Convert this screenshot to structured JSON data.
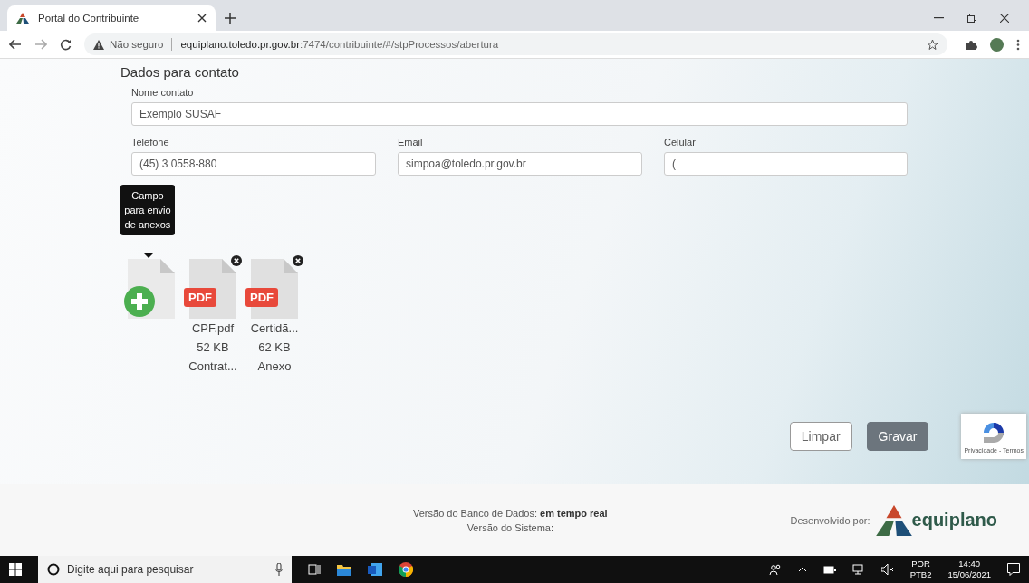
{
  "browser": {
    "tab_title": "Portal do Contribuinte",
    "security": "Não seguro",
    "url_host": "equiplano.toledo.pr.gov.br",
    "url_path": ":7474/contribuinte/#/stpProcessos/abertura"
  },
  "form": {
    "section_title": "Dados para contato",
    "fields": [
      {
        "label": "Nome contato",
        "value": "Exemplo SUSAF",
        "kind": "wide"
      },
      {
        "label": "Telefone",
        "value": "(45) 3 0558-880",
        "kind": "narrow"
      },
      {
        "label": "Email",
        "value": "simpoa@toledo.pr.gov.br",
        "kind": "narrow"
      },
      {
        "label": "Celular",
        "value": "(",
        "kind": "narrow"
      }
    ],
    "tooltip": "Campo para envio de anexos",
    "attachments": [
      {
        "kind": "pdf",
        "badge": "PDF",
        "name": "CPF.pdf",
        "size": "52 KB",
        "description": "Contrat..."
      },
      {
        "kind": "pdf",
        "badge": "PDF",
        "name": "Certidã...",
        "size": "62 KB",
        "description": "Anexo"
      }
    ],
    "buttons": [
      {
        "label": "Limpar",
        "kind": "outline"
      },
      {
        "label": "Gravar",
        "kind": "solid"
      }
    ],
    "recaptcha": "Privacidade - Termos"
  },
  "footer": {
    "db_version": "Versão do Banco de Dados: **em tempo real**",
    "system_version": "Versão do Sistema:",
    "developed_by": "Desenvolvido por:",
    "logo_text": "equiplano"
  },
  "taskbar": {
    "search_placeholder": "Digite aqui para pesquisar",
    "language": "POR",
    "layout": "PTB2",
    "time": "14:40",
    "date": "15/06/2021"
  }
}
